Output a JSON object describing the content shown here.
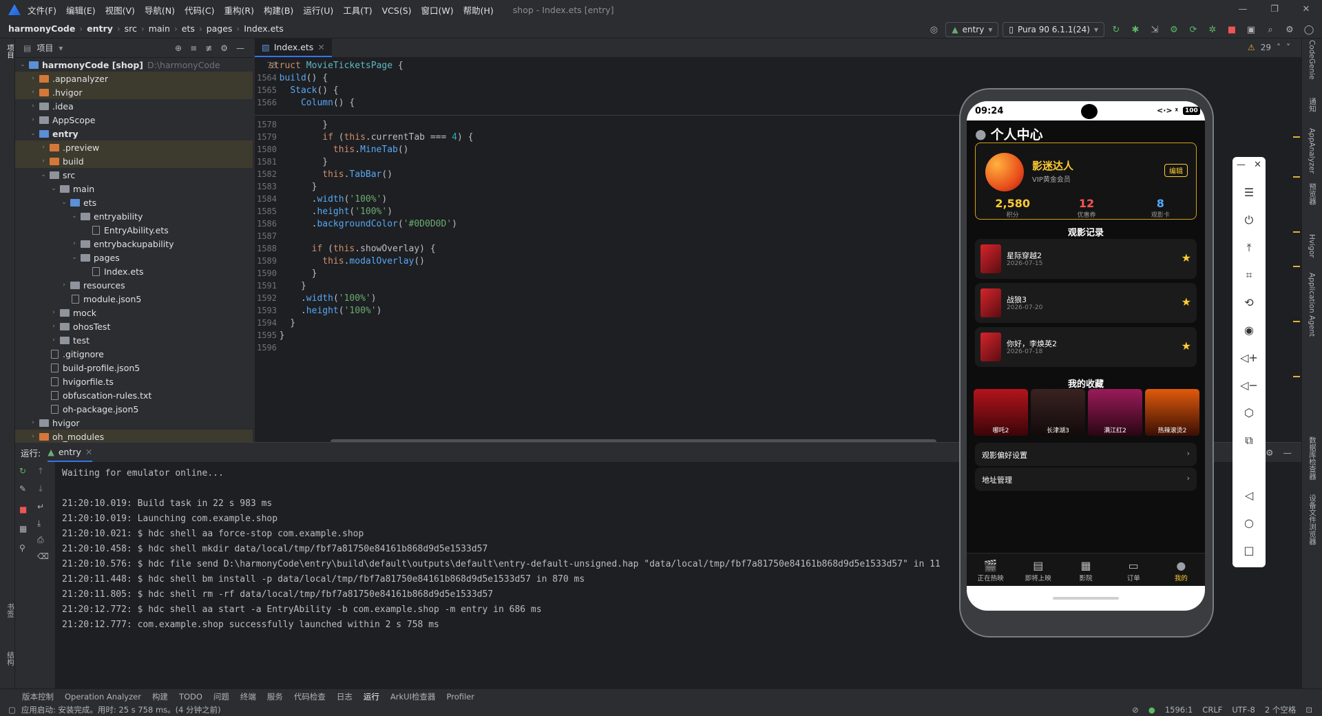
{
  "menu": [
    "文件(F)",
    "编辑(E)",
    "视图(V)",
    "导航(N)",
    "代码(C)",
    "重构(R)",
    "构建(B)",
    "运行(U)",
    "工具(T)",
    "VCS(S)",
    "窗口(W)",
    "帮助(H)"
  ],
  "window_title": "shop - Index.ets [entry]",
  "breadcrumb": [
    "harmonyCode",
    "entry",
    "src",
    "main",
    "ets",
    "pages",
    "Index.ets"
  ],
  "toolbar": {
    "module": "entry",
    "device": "Pura 90 6.1.1(24)"
  },
  "project": {
    "header": "项目",
    "rows": [
      {
        "a": "v",
        "t": "folder",
        "l": "harmonyCode [shop]",
        "d": "D:\\harmonyCode",
        "i": 0,
        "c": "b"
      },
      {
        "a": ">",
        "t": "folder",
        "l": ".appanalyzer",
        "i": 1,
        "c": "o",
        "ex": true
      },
      {
        "a": ">",
        "t": "folder",
        "l": ".hvigor",
        "i": 1,
        "c": "o",
        "ex": true
      },
      {
        "a": ">",
        "t": "folder",
        "l": ".idea",
        "i": 1
      },
      {
        "a": ">",
        "t": "folder",
        "l": "AppScope",
        "i": 1
      },
      {
        "a": "v",
        "t": "folder",
        "l": "entry",
        "i": 1,
        "c": "b",
        "bold": true
      },
      {
        "a": ">",
        "t": "folder",
        "l": ".preview",
        "i": 2,
        "c": "o",
        "ex": true
      },
      {
        "a": ">",
        "t": "folder",
        "l": "build",
        "i": 2,
        "c": "o",
        "ex": true
      },
      {
        "a": "v",
        "t": "folder",
        "l": "src",
        "i": 2
      },
      {
        "a": "v",
        "t": "folder",
        "l": "main",
        "i": 3
      },
      {
        "a": "v",
        "t": "folder",
        "l": "ets",
        "i": 4,
        "c": "b"
      },
      {
        "a": "v",
        "t": "folder",
        "l": "entryability",
        "i": 5
      },
      {
        "a": "",
        "t": "file",
        "l": "EntryAbility.ets",
        "i": 6
      },
      {
        "a": ">",
        "t": "folder",
        "l": "entrybackupability",
        "i": 5
      },
      {
        "a": "v",
        "t": "folder",
        "l": "pages",
        "i": 5
      },
      {
        "a": "",
        "t": "file",
        "l": "Index.ets",
        "i": 6
      },
      {
        "a": ">",
        "t": "folder",
        "l": "resources",
        "i": 4
      },
      {
        "a": "",
        "t": "file",
        "l": "module.json5",
        "i": 4
      },
      {
        "a": ">",
        "t": "folder",
        "l": "mock",
        "i": 3
      },
      {
        "a": ">",
        "t": "folder",
        "l": "ohosTest",
        "i": 3
      },
      {
        "a": ">",
        "t": "folder",
        "l": "test",
        "i": 3
      },
      {
        "a": "",
        "t": "file",
        "l": ".gitignore",
        "i": 2
      },
      {
        "a": "",
        "t": "file",
        "l": "build-profile.json5",
        "i": 2
      },
      {
        "a": "",
        "t": "file",
        "l": "hvigorfile.ts",
        "i": 2
      },
      {
        "a": "",
        "t": "file",
        "l": "obfuscation-rules.txt",
        "i": 2
      },
      {
        "a": "",
        "t": "file",
        "l": "oh-package.json5",
        "i": 2
      },
      {
        "a": ">",
        "t": "folder",
        "l": "hvigor",
        "i": 1
      },
      {
        "a": ">",
        "t": "folder",
        "l": "oh_modules",
        "i": 1,
        "c": "o",
        "ex": true
      }
    ]
  },
  "editor": {
    "tab": "Index.ets",
    "warnings": "29",
    "sticky": [
      {
        "n": "78",
        "html": "<span class='kw'>struct</span> <span class='ty'>MovieTicketsPage</span> {"
      },
      {
        "n": "1564",
        "html": "  <span class='fn'>build</span>() {"
      },
      {
        "n": "1565",
        "html": "    <span class='fn'>Stack</span>() {"
      },
      {
        "n": "1566",
        "html": "      <span class='fn'>Column</span>() {"
      }
    ],
    "lines": [
      {
        "n": "1578",
        "html": "          }"
      },
      {
        "n": "1579",
        "html": "          <span class='kw'>if</span> (<span class='kw'>this</span>.currentTab === <span class='nu'>4</span>) {"
      },
      {
        "n": "1580",
        "html": "            <span class='kw'>this</span>.<span class='fn'>MineTab</span>()"
      },
      {
        "n": "1581",
        "html": "          }"
      },
      {
        "n": "1582",
        "html": "          <span class='kw'>this</span>.<span class='fn'>TabBar</span>()"
      },
      {
        "n": "1583",
        "html": "        }"
      },
      {
        "n": "1584",
        "html": "        .<span class='fn'>width</span>(<span class='st'>'100%'</span>)"
      },
      {
        "n": "1585",
        "html": "        .<span class='fn'>height</span>(<span class='st'>'100%'</span>)"
      },
      {
        "n": "1586",
        "html": "        .<span class='fn'>backgroundColor</span>(<span class='st'>'#0D0D0D'</span>)"
      },
      {
        "n": "1587",
        "html": ""
      },
      {
        "n": "1588",
        "html": "        <span class='kw'>if</span> (<span class='kw'>this</span>.showOverlay) {"
      },
      {
        "n": "1589",
        "html": "          <span class='kw'>this</span>.<span class='fn'>modalOverlay</span>()"
      },
      {
        "n": "1590",
        "html": "        }"
      },
      {
        "n": "1591",
        "html": "      }"
      },
      {
        "n": "1592",
        "html": "      .<span class='fn'>width</span>(<span class='st'>'100%'</span>)"
      },
      {
        "n": "1593",
        "html": "      .<span class='fn'>height</span>(<span class='st'>'100%'</span>)"
      },
      {
        "n": "1594",
        "html": "    }"
      },
      {
        "n": "1595",
        "html": "  }"
      },
      {
        "n": "1596",
        "html": ""
      }
    ]
  },
  "run": {
    "label": "运行:",
    "tab": "entry",
    "console": [
      "Waiting for emulator online...",
      "",
      "21:20:10.019: Build task in 22 s 983 ms",
      "21:20:10.019: Launching com.example.shop",
      "21:20:10.021: $ hdc shell aa force-stop com.example.shop",
      "21:20:10.458: $ hdc shell mkdir data/local/tmp/fbf7a81750e84161b868d9d5e1533d57",
      "21:20:10.576: $ hdc file send D:\\harmonyCode\\entry\\build\\default\\outputs\\default\\entry-default-unsigned.hap \"data/local/tmp/fbf7a81750e84161b868d9d5e1533d57\" in 11",
      "21:20:11.448: $ hdc shell bm install -p data/local/tmp/fbf7a81750e84161b868d9d5e1533d57 in 870 ms",
      "21:20:11.805: $ hdc shell rm -rf data/local/tmp/fbf7a81750e84161b868d9d5e1533d57",
      "21:20:12.772: $ hdc shell aa start -a EntryAbility -b com.example.shop -m entry in 686 ms",
      "21:20:12.777: com.example.shop successfully launched within 2 s 758 ms"
    ]
  },
  "toolwindows": [
    "版本控制",
    "Operation Analyzer",
    "构建",
    "TODO",
    "问题",
    "终端",
    "服务",
    "代码检查",
    "日志",
    "运行",
    "ArkUI检查器",
    "Profiler"
  ],
  "status": {
    "msg": "应用启动: 安装完成。用时: 25 s 758 ms。(4 分钟之前)",
    "pos": "1596:1",
    "eol": "CRLF",
    "enc": "UTF-8",
    "indent": "2 个空格"
  },
  "left_strip": [
    "项目",
    "书签",
    "结构"
  ],
  "right_strip": [
    "CodeGenie",
    "通知",
    "AppAnalyzer",
    "预览器",
    "Hvigor",
    "Application Agent",
    "数据库检查器",
    "设备文件浏览器"
  ],
  "phone": {
    "time": "09:24",
    "battery": "100",
    "page_title": "个人中心",
    "user": {
      "name": "影迷达人",
      "level": "VIP黄金会员",
      "edit": "编辑"
    },
    "stats": [
      {
        "v": "2,580",
        "l": "积分"
      },
      {
        "v": "12",
        "l": "优惠券"
      },
      {
        "v": "8",
        "l": "观影卡"
      }
    ],
    "history_title": "观影记录",
    "history": [
      {
        "t": "星际穿越2",
        "d": "2026-07-15"
      },
      {
        "t": "战狼3",
        "d": "2026-07-20"
      },
      {
        "t": "你好，李焕英2",
        "d": "2026-07-18"
      }
    ],
    "fav_title": "我的收藏",
    "favs": [
      "哪吒2",
      "长津湖3",
      "满江红2",
      "热辣滚烫2"
    ],
    "settings": [
      "观影偏好设置",
      "地址管理"
    ],
    "tabs": [
      "正在热映",
      "即将上映",
      "影院",
      "订单",
      "我的"
    ]
  },
  "colors": {
    "accent": "#ffcc33",
    "ide_bg": "#1e1f22",
    "panel_bg": "#2b2d30"
  }
}
